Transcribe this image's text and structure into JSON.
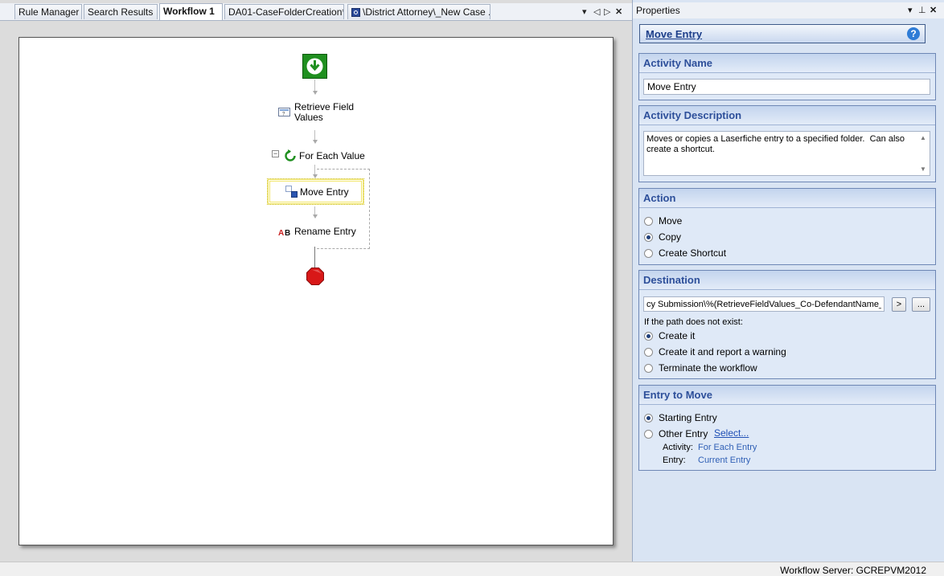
{
  "tabs": [
    {
      "label": "Rule Manager",
      "active": false
    },
    {
      "label": "Search Results",
      "active": false
    },
    {
      "label": "Workflow 1",
      "active": true
    },
    {
      "label": "DA01-CaseFolderCreation*",
      "active": false
    },
    {
      "label": "\\District Attorney\\_New Case ...",
      "active": false,
      "icon": "workflow-doc-icon"
    }
  ],
  "tab_controls": {
    "dropdown": "▾",
    "prev": "◁",
    "next": "▷",
    "close": "✕"
  },
  "workflow": {
    "nodes": [
      {
        "id": "start",
        "icon": "start-arrow-icon"
      },
      {
        "id": "retrieve",
        "label_line1": "Retrieve Field",
        "label_line2": "Values",
        "icon": "retrieve-field-icon"
      },
      {
        "id": "foreach",
        "label": "For Each Value",
        "icon": "loop-icon",
        "collapse": "⊟"
      },
      {
        "id": "move",
        "label": "Move Entry",
        "icon": "move-entry-icon",
        "selected": true
      },
      {
        "id": "rename",
        "label": "Rename Entry",
        "icon": "rename-entry-icon"
      },
      {
        "id": "end",
        "icon": "stop-icon"
      }
    ]
  },
  "properties": {
    "title": "Properties",
    "controls": {
      "dropdown": "▾",
      "pin": "⊥",
      "close": "✕"
    },
    "activity_title": "Move Entry",
    "help": "?",
    "sections": {
      "activity_name": {
        "header": "Activity Name",
        "value": "Move Entry"
      },
      "activity_description": {
        "header": "Activity Description",
        "value": "Moves or copies a Laserfiche entry to a specified folder.  Can also create a shortcut."
      },
      "action": {
        "header": "Action",
        "options": [
          {
            "label": "Move",
            "checked": false
          },
          {
            "label": "Copy",
            "checked": true
          },
          {
            "label": "Create Shortcut",
            "checked": false
          }
        ]
      },
      "destination": {
        "header": "Destination",
        "path": "cy Submission\\%(RetrieveFieldValues_Co-DefendantName_All",
        "arrow_btn": ">",
        "browse_btn": "...",
        "if_missing_label": "If the path does not exist:",
        "options": [
          {
            "label": "Create it",
            "checked": true
          },
          {
            "label": "Create it and report a warning",
            "checked": false
          },
          {
            "label": "Terminate the workflow",
            "checked": false
          }
        ]
      },
      "entry_to_move": {
        "header": "Entry to Move",
        "options": [
          {
            "label": "Starting Entry",
            "checked": true
          },
          {
            "label": "Other Entry",
            "checked": false
          }
        ],
        "select_link": "Select...",
        "activity_label": "Activity:",
        "activity_value": "For Each Entry",
        "entry_label": "Entry:",
        "entry_value": "Current Entry"
      }
    }
  },
  "status": {
    "text": "Workflow Server: GCREPVM2012"
  },
  "colors": {
    "start_green": "#1f8f1f",
    "stop_red": "#d81818",
    "selection_yellow": "#f2e66b",
    "header_blue": "#2d4f9a"
  }
}
